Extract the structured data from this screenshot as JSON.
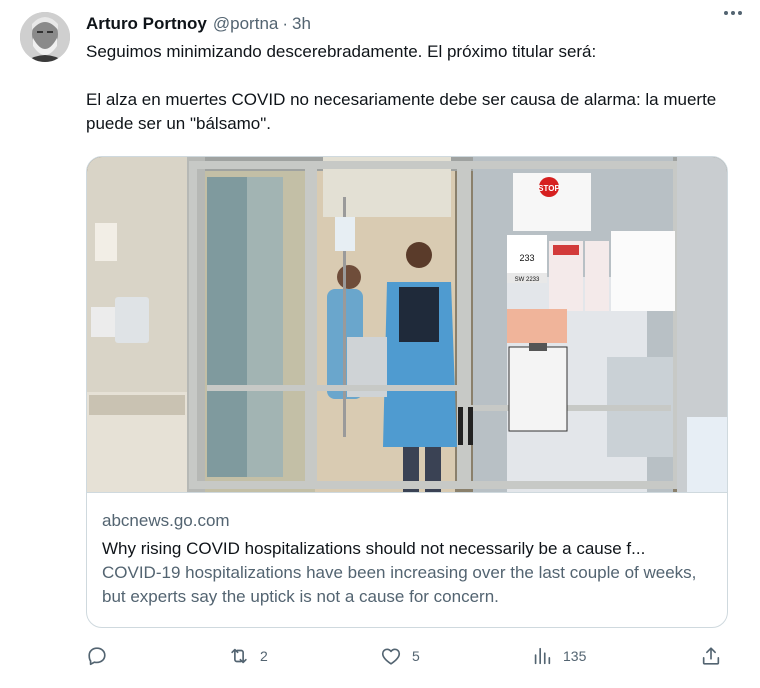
{
  "tweet": {
    "display_name": "Arturo Portnoy",
    "handle": "@portna",
    "separator": "·",
    "time": "3h",
    "more_icon": "more-horizontal-icon",
    "text_line1": "Seguimos minimizando descerebradamente. El próximo titular será:",
    "text_line2": "El alza en muertes COVID no necesariamente debe ser causa de alarma: la muerte puede ser un \"bálsamo\"."
  },
  "card": {
    "image_alt": "Hospital ICU room seen through glass doors with healthcare workers in protective gowns",
    "door_sign_room": "233",
    "door_sign_code": "SW 2233",
    "door_sign_stop": "STOP",
    "domain": "abcnews.go.com",
    "title": "Why rising COVID hospitalizations should not necessarily be a cause f...",
    "description": "COVID-19 hospitalizations have been increasing over the last couple of weeks, but experts say the uptick is not a cause for concern."
  },
  "actions": {
    "reply_icon": "reply-icon",
    "reply_count": "",
    "retweet_icon": "retweet-icon",
    "retweet_count": "2",
    "like_icon": "heart-icon",
    "like_count": "5",
    "views_icon": "views-chart-icon",
    "views_count": "135",
    "share_icon": "share-icon"
  },
  "colors": {
    "text_primary": "#0f1419",
    "text_secondary": "#536471",
    "border": "#cfd9de"
  }
}
